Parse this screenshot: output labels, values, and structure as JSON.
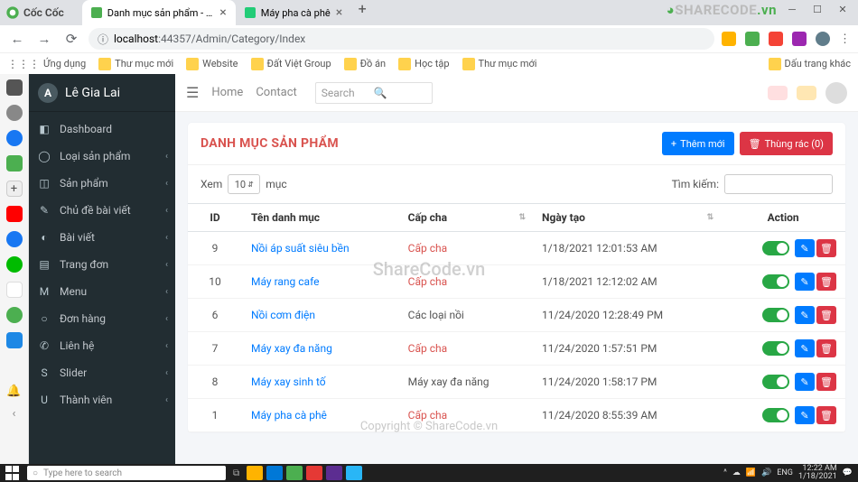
{
  "browser": {
    "logo_text": "Cốc Cốc",
    "tabs": [
      {
        "title": "Danh mục sản phẩm - Quản ..."
      },
      {
        "title": "Máy pha cà phê"
      }
    ],
    "url_host": "localhost",
    "url_port_path": ":44357/Admin/Category/Index",
    "bookmarks_label": "Ứng dụng",
    "bookmarks": [
      "Thư mục mới",
      "Website",
      "Đất Việt Group",
      "Đồ án",
      "Học tập",
      "Thư mục mới"
    ],
    "bm_right": "Dấu trang khác"
  },
  "sidebar": {
    "brand": "Lê Gia Lai",
    "items": [
      {
        "icon": "◧",
        "label": "Dashboard",
        "chev": ""
      },
      {
        "icon": "◯",
        "label": "Loại sản phẩm",
        "chev": "‹"
      },
      {
        "icon": "◫",
        "label": "Sản phẩm",
        "chev": "‹"
      },
      {
        "icon": "✎",
        "label": "Chủ đề bài viết",
        "chev": "‹"
      },
      {
        "icon": "◐",
        "label": "Bài viết",
        "chev": "‹"
      },
      {
        "icon": "▤",
        "label": "Trang đơn",
        "chev": "‹"
      },
      {
        "icon": "M",
        "label": "Menu",
        "chev": "‹"
      },
      {
        "icon": "○",
        "label": "Đơn hàng",
        "chev": "‹"
      },
      {
        "icon": "✆",
        "label": "Liên hệ",
        "chev": "‹"
      },
      {
        "icon": "S",
        "label": "Slider",
        "chev": "‹"
      },
      {
        "icon": "U",
        "label": "Thành viên",
        "chev": "‹"
      }
    ]
  },
  "topbar": {
    "home": "Home",
    "contact": "Contact",
    "search_ph": "Search"
  },
  "page": {
    "title": "DANH MỤC SẢN PHẨM",
    "add": "Thêm mới",
    "trash": "Thùng rác (0)",
    "show": "Xem",
    "pagelen": "10",
    "entries": "mục",
    "search_lbl": "Tìm kiếm:"
  },
  "table": {
    "headers": {
      "id": "ID",
      "name": "Tên danh mục",
      "parent": "Cấp cha",
      "date": "Ngày tạo",
      "action": "Action"
    },
    "rows": [
      {
        "id": "9",
        "name": "Nồi áp suất siêu bền",
        "parent": "Cấp cha",
        "parent_cls": "parent",
        "date": "1/18/2021 12:01:53 AM"
      },
      {
        "id": "10",
        "name": "Máy rang cafe",
        "parent": "Cấp cha",
        "parent_cls": "parent",
        "date": "1/18/2021 12:12:02 AM"
      },
      {
        "id": "6",
        "name": "Nồi cơm điện",
        "parent": "Các loại nồi",
        "parent_cls": "",
        "date": "11/24/2020 12:28:49 PM"
      },
      {
        "id": "7",
        "name": "Máy xay đa năng",
        "parent": "Cấp cha",
        "parent_cls": "parent",
        "date": "11/24/2020 1:57:51 PM"
      },
      {
        "id": "8",
        "name": "Máy xay sinh tố",
        "parent": "Máy xay đa năng",
        "parent_cls": "",
        "date": "11/24/2020 1:58:17 PM"
      },
      {
        "id": "1",
        "name": "Máy pha cà phê",
        "parent": "Cấp cha",
        "parent_cls": "parent",
        "date": "11/24/2020 8:55:39 AM"
      }
    ]
  },
  "taskbar": {
    "search_ph": "Type here to search",
    "lang": "ENG",
    "time": "12:22 AM",
    "date": "1/18/2021"
  },
  "watermark": {
    "center": "ShareCode.vn",
    "copy": "Copyright © ShareCode.vn"
  }
}
